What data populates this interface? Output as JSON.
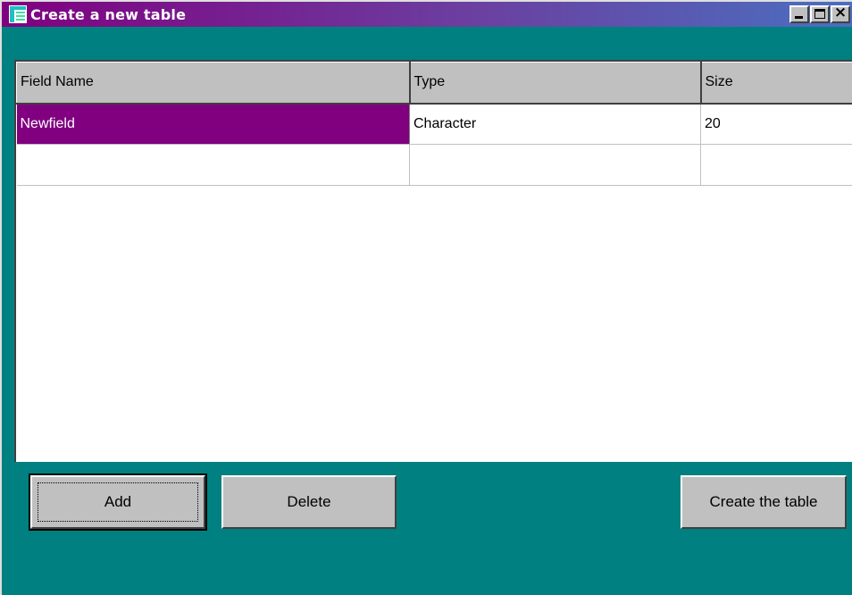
{
  "window": {
    "title": "Create a new table",
    "controls": {
      "minimize": "minimize-icon",
      "maximize": "maximize-icon",
      "close": "close-icon"
    },
    "colors": {
      "titlebar_start": "#800080",
      "titlebar_end": "#4a6fc0",
      "background": "#008080",
      "selection": "#800080"
    }
  },
  "grid": {
    "columns": [
      "Field Name",
      "Type",
      "Size"
    ],
    "rows": [
      [
        "Newfield",
        "Character",
        "20"
      ],
      [
        "",
        "",
        ""
      ]
    ],
    "selected_cell": "Newfield"
  },
  "buttons": {
    "add": "Add",
    "delete": "Delete",
    "create": "Create the table"
  }
}
